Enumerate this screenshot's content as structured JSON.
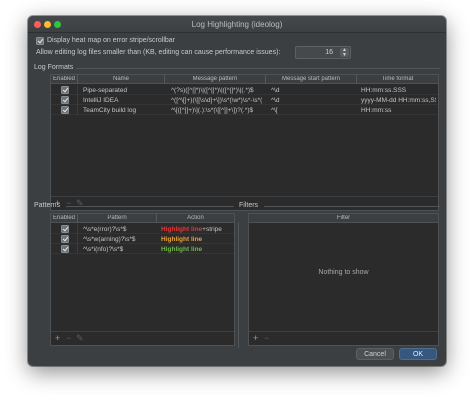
{
  "window": {
    "title": "Log Highlighting (ideolog)"
  },
  "options": {
    "heatmap_label": "Display heat map on error stripe/scrollbar",
    "heatmap_checked": true,
    "size_label": "Allow editing log files smaller than (KB, editing can cause performance issues):",
    "size_value": "16"
  },
  "log_formats": {
    "title": "Log Formats",
    "columns": [
      "Enabled",
      "Name",
      "Message pattern",
      "Message start pattern",
      "Time format"
    ],
    "rows": [
      {
        "enabled": true,
        "name": "Pipe-separated",
        "pattern": "^(?s)([^|]*)\\|([^|]*)\\|([^|]*)\\|(.*)$",
        "start": "^\\d",
        "time": "HH:mm:ss.SSS"
      },
      {
        "enabled": true,
        "name": "IntelliJ IDEA",
        "pattern": "^([^\\[]+)(\\[[\\s\\d]+\\])\\s*(\\w*)\\s*-\\s*(.*)$",
        "start": "^\\d",
        "time": "yyyy-MM-dd HH:mm:ss,SSS"
      },
      {
        "enabled": true,
        "name": "TeamCity build log",
        "pattern": "^\\[([^]]+)\\](.):\\s*(\\[[^]]+\\])?(.*)$",
        "start": "^\\[",
        "time": "HH:mm:ss"
      }
    ],
    "add_label": "+",
    "remove_label": "−",
    "edit_label": "✎"
  },
  "patterns": {
    "title": "Patterns",
    "columns": [
      "Enabled",
      "Pattern",
      "Action"
    ],
    "rows": [
      {
        "enabled": true,
        "pattern": "^\\s*e(rror)?\\s*$",
        "action": "Highlight line",
        "suffix": "+stripe",
        "color": "#e03a3a"
      },
      {
        "enabled": true,
        "pattern": "^\\s*w(arning)?\\s*$",
        "action": "Highlight line",
        "suffix": "",
        "color": "#e8a33c"
      },
      {
        "enabled": true,
        "pattern": "^\\s*i(nfo)?\\s*$",
        "action": "Highlight line",
        "suffix": "",
        "color": "#6fb54a"
      }
    ],
    "add_label": "+",
    "remove_label": "−",
    "edit_label": "✎"
  },
  "filters": {
    "title": "Filters",
    "columns": [
      "Filter"
    ],
    "empty_text": "Nothing to show",
    "add_label": "+",
    "remove_label": "−"
  },
  "buttons": {
    "cancel": "Cancel",
    "ok": "OK"
  }
}
